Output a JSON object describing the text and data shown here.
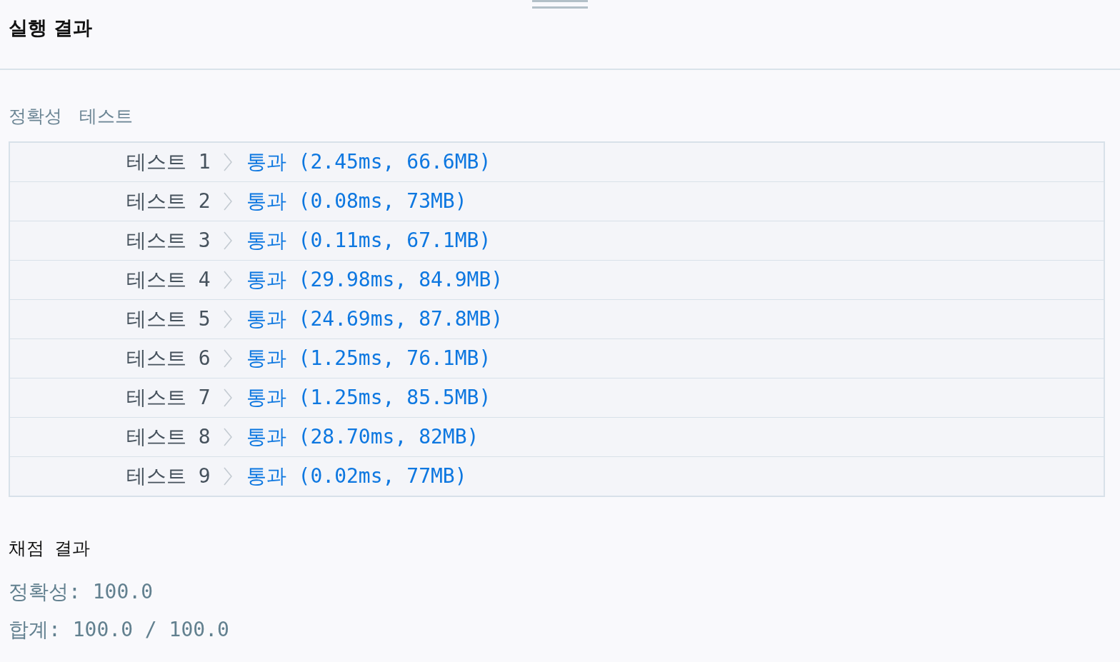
{
  "panel": {
    "title": "실행 결과"
  },
  "accuracy_test": {
    "heading": "정확성 테스트",
    "results": [
      {
        "label": "테스트 1",
        "result": "통과 (2.45ms, 66.6MB)"
      },
      {
        "label": "테스트 2",
        "result": "통과 (0.08ms, 73MB)"
      },
      {
        "label": "테스트 3",
        "result": "통과 (0.11ms, 67.1MB)"
      },
      {
        "label": "테스트 4",
        "result": "통과 (29.98ms, 84.9MB)"
      },
      {
        "label": "테스트 5",
        "result": "통과 (24.69ms, 87.8MB)"
      },
      {
        "label": "테스트 6",
        "result": "통과 (1.25ms, 76.1MB)"
      },
      {
        "label": "테스트 7",
        "result": "통과 (1.25ms, 85.5MB)"
      },
      {
        "label": "테스트 8",
        "result": "통과 (28.70ms, 82MB)"
      },
      {
        "label": "테스트 9",
        "result": "통과 (0.02ms, 77MB)"
      }
    ]
  },
  "grading": {
    "title": "채점 결과",
    "lines": [
      "정확성: 100.0",
      "합계: 100.0 / 100.0"
    ]
  }
}
